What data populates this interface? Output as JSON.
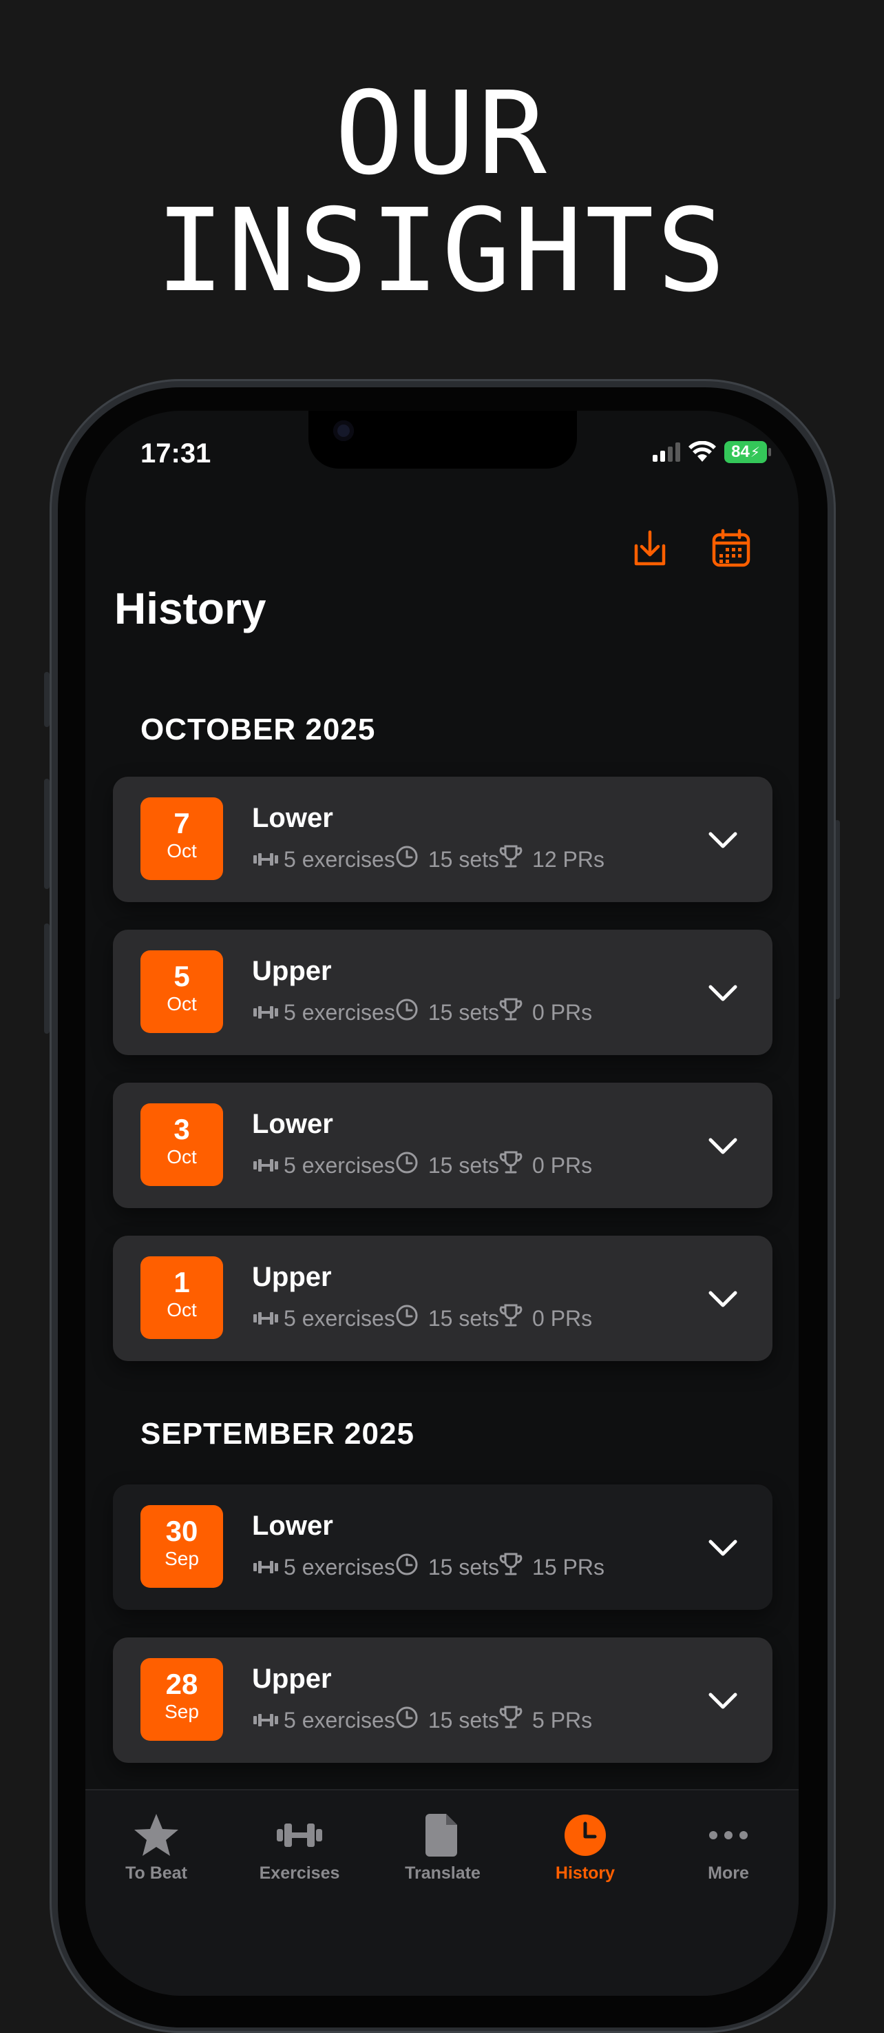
{
  "headline": {
    "line1": "OUR",
    "line2": "INSIGHTS"
  },
  "status": {
    "time": "17:31",
    "battery": "84"
  },
  "header": {
    "title": "History",
    "download_icon": "download-icon",
    "calendar_icon": "calendar-icon"
  },
  "accent_color": "#ff5f00",
  "sections": [
    {
      "label": "OCTOBER 2025",
      "workouts": [
        {
          "day": "7",
          "month": "Oct",
          "name": "Lower",
          "exercises": "5 exercises",
          "sets": "15 sets",
          "prs": "12 PRs"
        },
        {
          "day": "5",
          "month": "Oct",
          "name": "Upper",
          "exercises": "5 exercises",
          "sets": "15 sets",
          "prs": "0 PRs"
        },
        {
          "day": "3",
          "month": "Oct",
          "name": "Lower",
          "exercises": "5 exercises",
          "sets": "15 sets",
          "prs": "0 PRs"
        },
        {
          "day": "1",
          "month": "Oct",
          "name": "Upper",
          "exercises": "5 exercises",
          "sets": "15 sets",
          "prs": "0 PRs"
        }
      ]
    },
    {
      "label": "SEPTEMBER 2025",
      "workouts": [
        {
          "day": "30",
          "month": "Sep",
          "name": "Lower",
          "exercises": "5 exercises",
          "sets": "15 sets",
          "prs": "15 PRs"
        },
        {
          "day": "28",
          "month": "Sep",
          "name": "Upper",
          "exercises": "5 exercises",
          "sets": "15 sets",
          "prs": "5 PRs"
        }
      ]
    }
  ],
  "tabs": [
    {
      "label": "To Beat",
      "icon": "star-icon",
      "active": false
    },
    {
      "label": "Exercises",
      "icon": "dumbbell-icon",
      "active": false
    },
    {
      "label": "Translate",
      "icon": "document-icon",
      "active": false
    },
    {
      "label": "History",
      "icon": "clock-icon",
      "active": true
    },
    {
      "label": "More",
      "icon": "ellipsis-icon",
      "active": false
    }
  ]
}
